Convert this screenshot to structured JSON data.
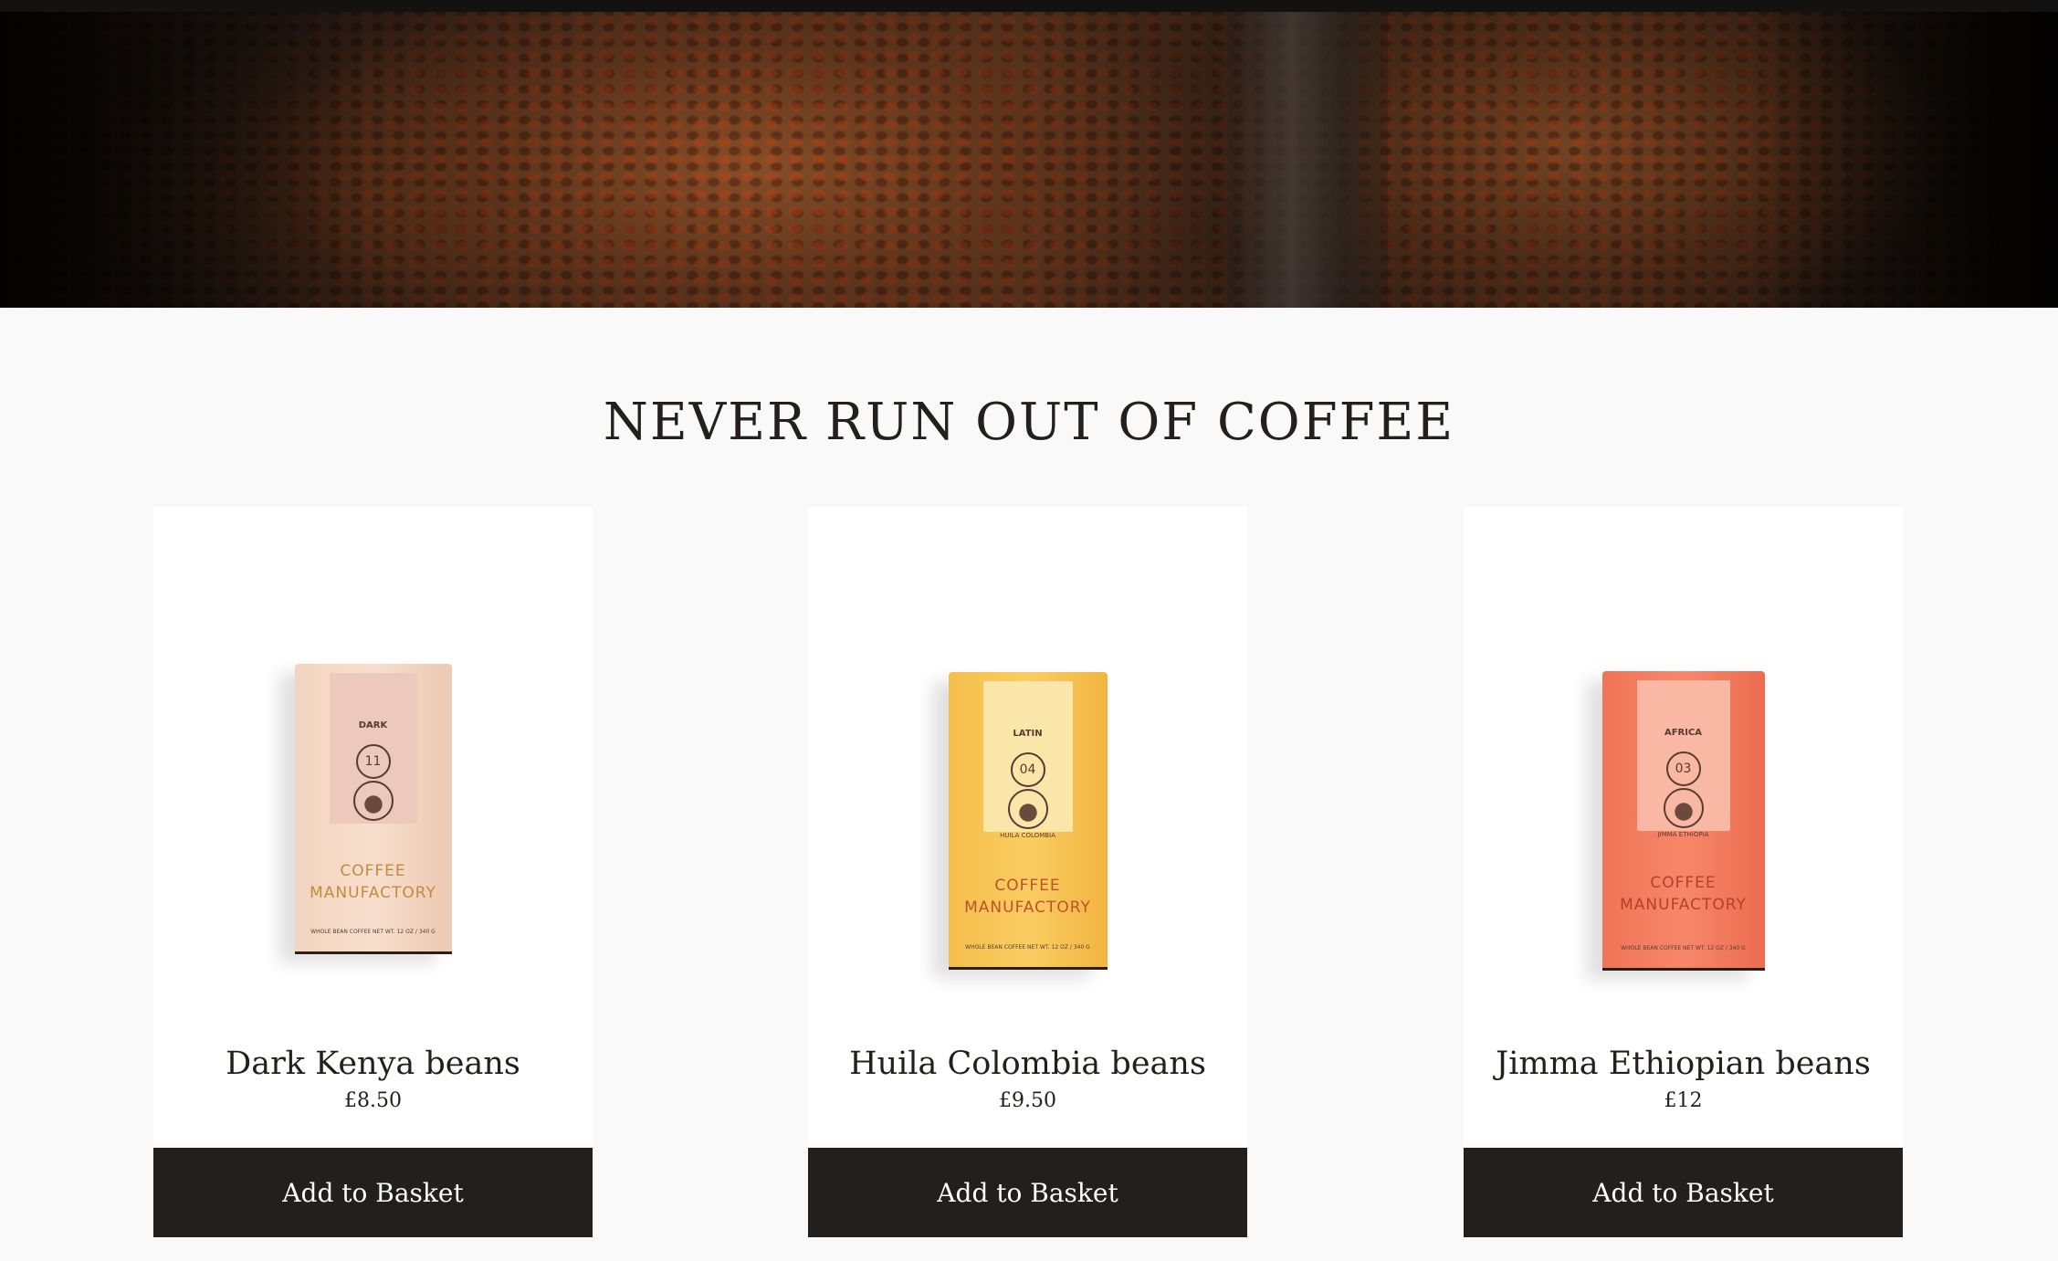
{
  "section": {
    "title": "NEVER RUN OUT OF COFFEE"
  },
  "products": [
    {
      "name": "Dark Kenya beans",
      "price": "£8.50",
      "button_label": "Add to Basket",
      "bag": {
        "series": "DARK",
        "number": "11",
        "origin": "",
        "brand": "COFFEE MANUFACTORY",
        "net": "WHOLE BEAN COFFEE NET WT. 12 OZ / 340 G",
        "color": "#f2d4bf"
      }
    },
    {
      "name": "Huila Colombia beans",
      "price": "£9.50",
      "button_label": "Add to Basket",
      "bag": {
        "series": "LATIN",
        "number": "04",
        "origin": "HUILA COLOMBIA",
        "brand": "COFFEE MANUFACTORY",
        "net": "WHOLE BEAN COFFEE NET WT. 12 OZ / 340 G",
        "color": "#f5be4b"
      }
    },
    {
      "name": "Jimma Ethiopian beans",
      "price": "£12",
      "button_label": "Add to Basket",
      "bag": {
        "series": "AFRICA",
        "number": "03",
        "origin": "JIMMA ETHIOPIA",
        "brand": "COFFEE MANUFACTORY",
        "net": "WHOLE BEAN COFFEE NET WT. 12 OZ / 340 G",
        "color": "#f07456"
      }
    }
  ],
  "colors": {
    "button_bg": "#231f1c",
    "page_bg": "#f9f9f9",
    "card_bg": "#ffffff"
  }
}
